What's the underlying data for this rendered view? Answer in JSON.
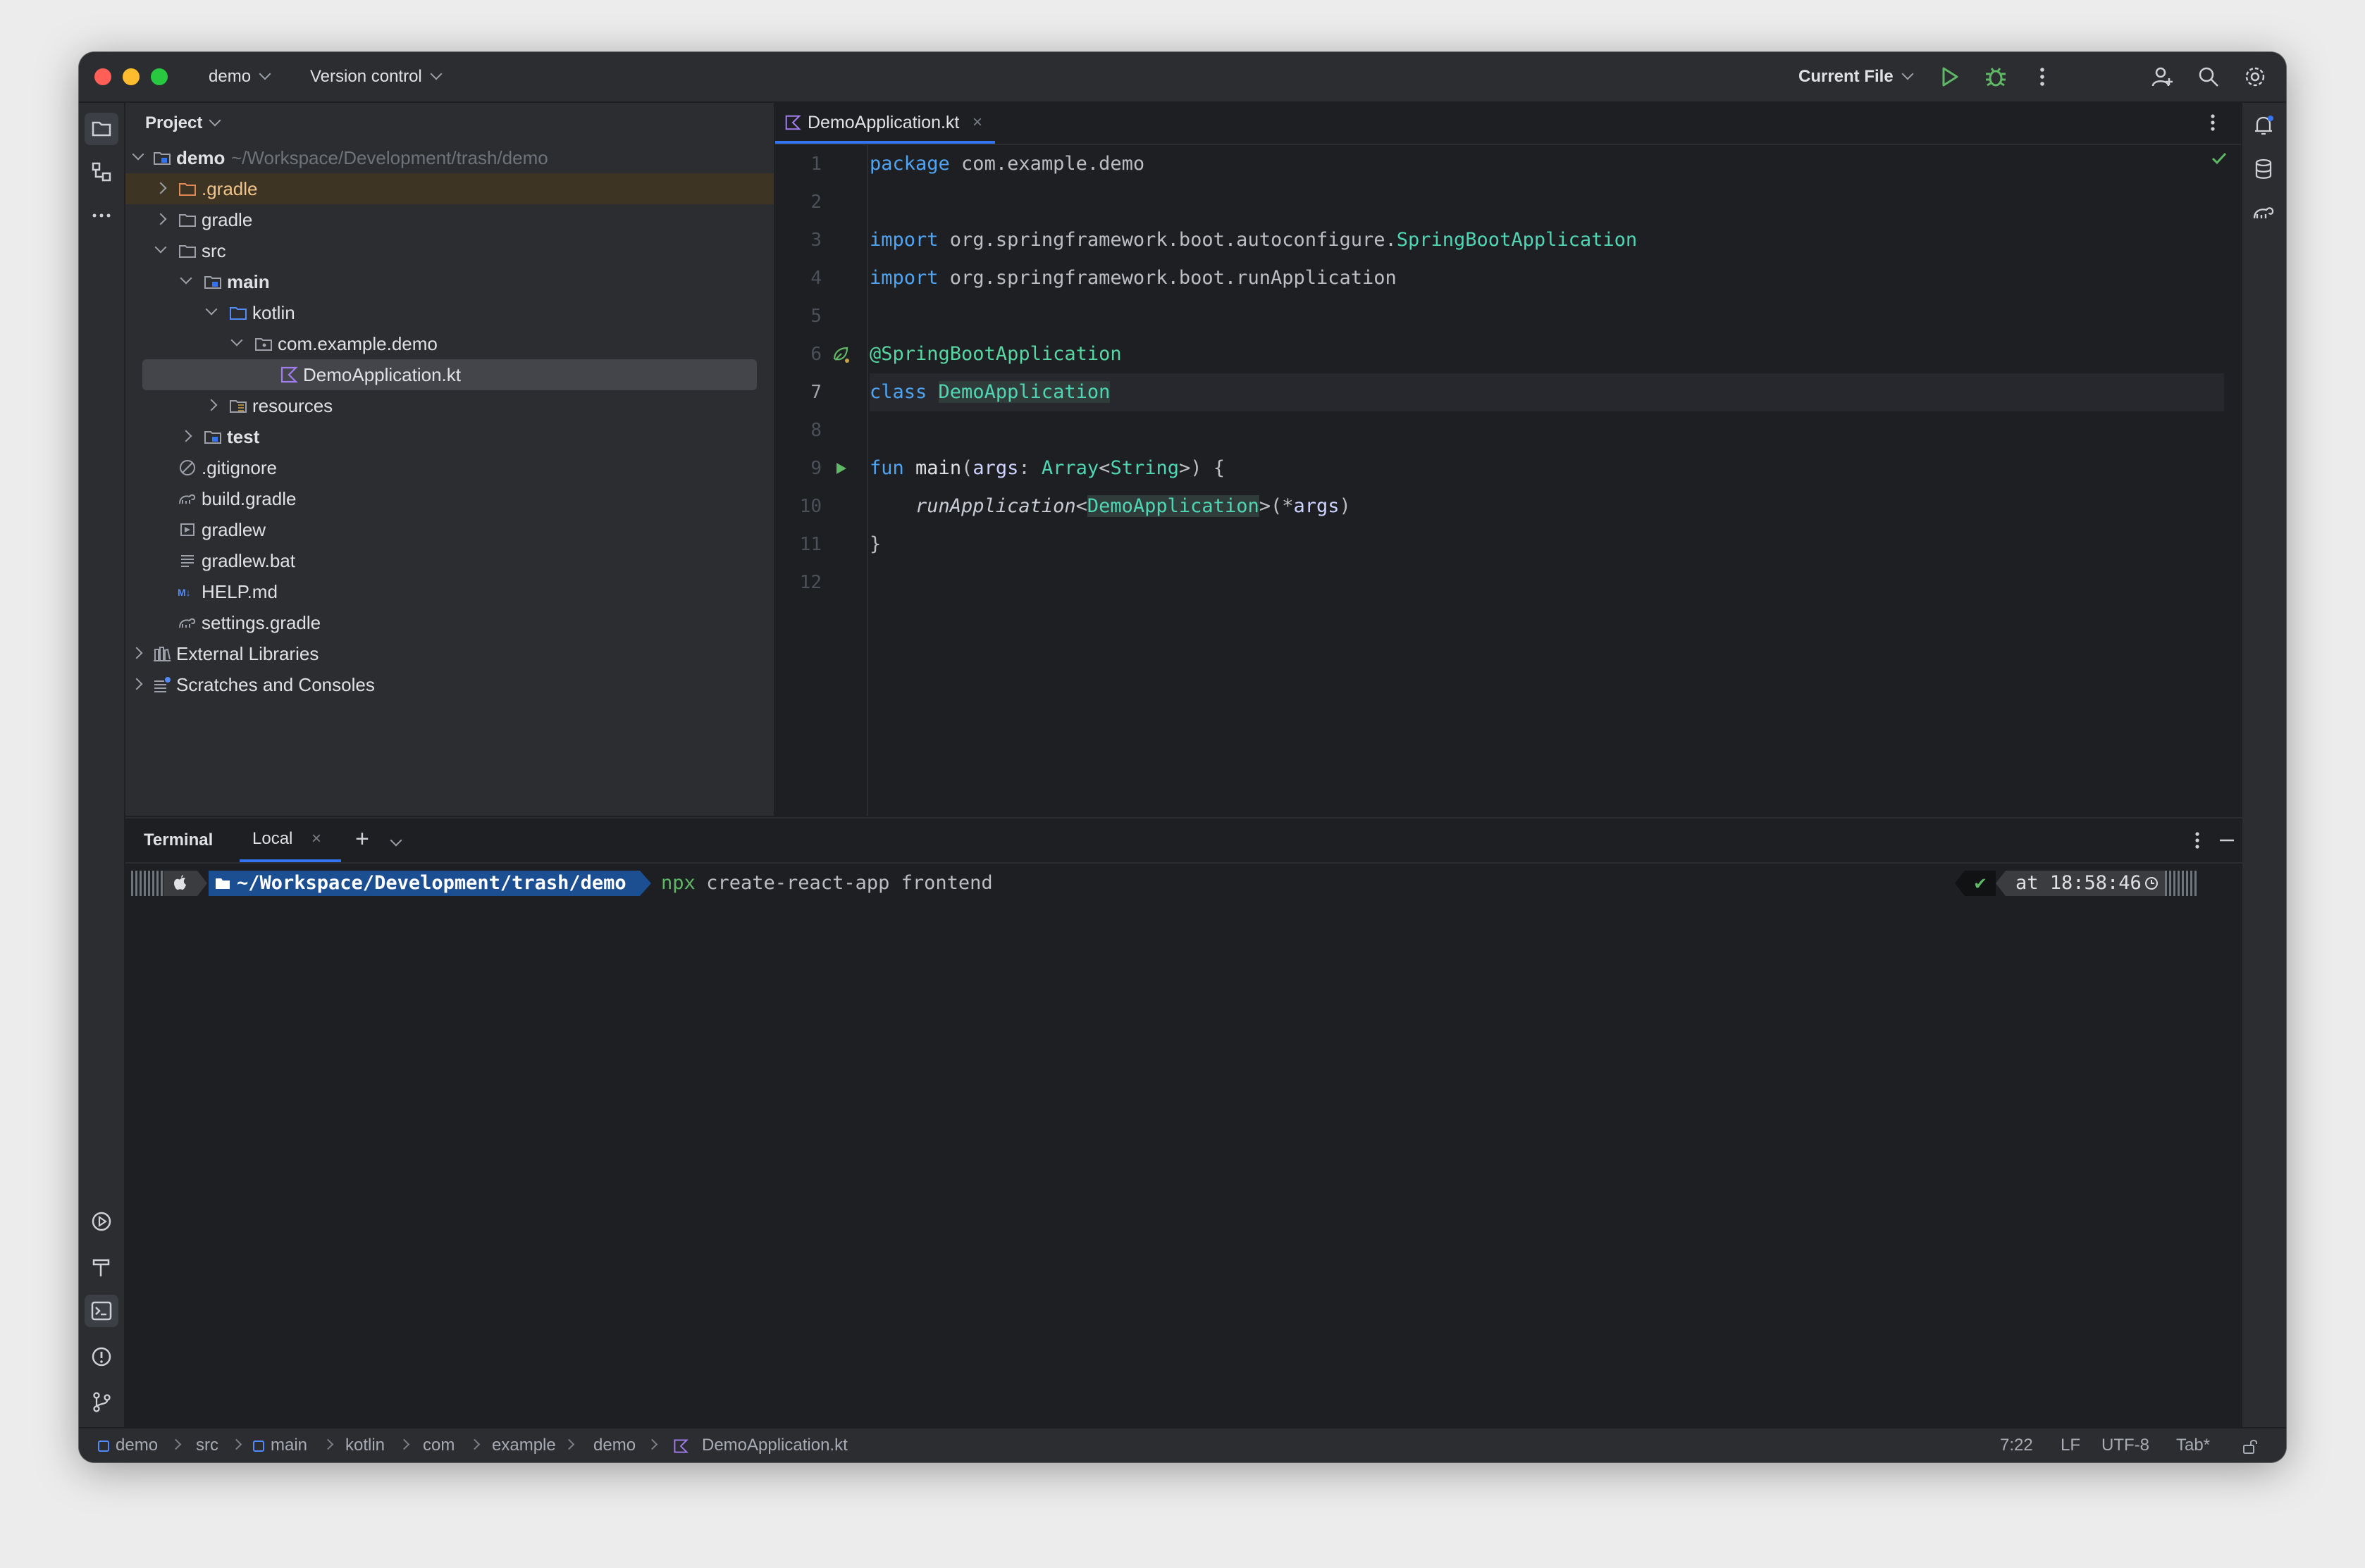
{
  "titlebar": {
    "project_name": "demo",
    "vcs_menu": "Version control",
    "run_config": "Current File"
  },
  "project_panel": {
    "title": "Project",
    "root": {
      "name": "demo",
      "path": "~/Workspace/Development/trash/demo"
    },
    "items": [
      {
        "label": ".gradle"
      },
      {
        "label": "gradle"
      },
      {
        "label": "src"
      },
      {
        "label": "main"
      },
      {
        "label": "kotlin"
      },
      {
        "label": "com.example.demo"
      },
      {
        "label": "DemoApplication.kt"
      },
      {
        "label": "resources"
      },
      {
        "label": "test"
      },
      {
        "label": ".gitignore"
      },
      {
        "label": "build.gradle"
      },
      {
        "label": "gradlew"
      },
      {
        "label": "gradlew.bat"
      },
      {
        "label": "HELP.md"
      },
      {
        "label": "settings.gradle"
      },
      {
        "label": "External Libraries"
      },
      {
        "label": "Scratches and Consoles"
      }
    ]
  },
  "editor": {
    "tab_label": "DemoApplication.kt",
    "tab_close": "×",
    "line_numbers": [
      "1",
      "2",
      "3",
      "4",
      "5",
      "6",
      "7",
      "8",
      "9",
      "10",
      "11",
      "12"
    ],
    "code": {
      "l1_kw": "package",
      "l1_rest": " com.example.demo",
      "l3_kw": "import",
      "l3_pkg": " org.springframework.boot.autoconfigure.",
      "l3_cls": "SpringBootApplication",
      "l4_kw": "import",
      "l4_rest": " org.springframework.boot.runApplication",
      "l6_ann": "@SpringBootApplication",
      "l7_kw": "class",
      "l7_cls": "DemoApplication",
      "l9_kw": "fun",
      "l9_fn": "main",
      "l9_open": "(",
      "l9_param": "args",
      "l9_colon": ": ",
      "l9_type1": "Array",
      "l9_lt": "<",
      "l9_type2": "String",
      "l9_close": ">) {",
      "l10_fn": "runApplication",
      "l10_lt": "<",
      "l10_cls": "DemoApplication",
      "l10_gt": ">(*",
      "l10_param": "args",
      "l10_end": ")",
      "l11": "}"
    }
  },
  "terminal": {
    "title": "Terminal",
    "tab_label": "Local",
    "tab_close": "×",
    "add": "+",
    "prompt_path": "~/Workspace/Development/trash/demo",
    "cmd_name": "npx",
    "cmd_args": " create-react-app frontend",
    "status_check": "✔",
    "time": "at 18:58:46"
  },
  "statusbar": {
    "breadcrumbs": [
      "demo",
      "src",
      "main",
      "kotlin",
      "com",
      "example",
      "demo",
      "DemoApplication.kt"
    ],
    "position": "7:22",
    "line_ending": "LF",
    "encoding": "UTF-8",
    "indent": "Tab*"
  },
  "colors": {
    "accent": "#3574f0",
    "run_green": "#5fb865",
    "window_bg": "#1e1f22",
    "panel_bg": "#2b2d30"
  }
}
